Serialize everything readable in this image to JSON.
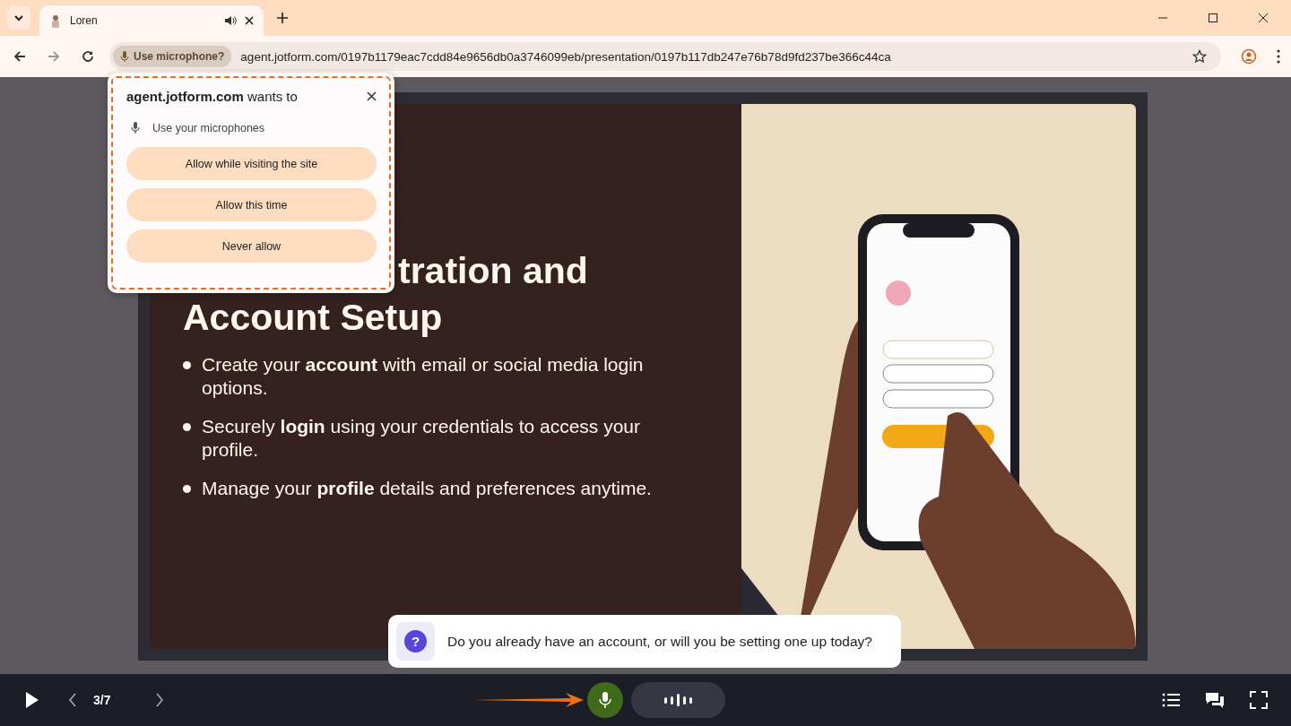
{
  "tab": {
    "title": "Loren"
  },
  "address_bar": {
    "permission_chip": "Use microphone?",
    "url": "agent.jotform.com/0197b1179eac7cdd84e9656db0a3746099eb/presentation/0197b117db247e76b78d9fd237be366c44ca"
  },
  "permission_popup": {
    "site": "agent.jotform.com",
    "title_rest": " wants to",
    "permission": "Use your microphones",
    "buttons": [
      "Allow while visiting the site",
      "Allow this time",
      "Never allow"
    ]
  },
  "slide": {
    "title_lines": [
      "tration and",
      "Account Setup"
    ],
    "bullets": [
      "Create your **account** with email or social media login options.",
      "Securely **login** using your credentials to access your profile.",
      "Manage your **profile** details and preferences anytime."
    ]
  },
  "question": {
    "icon": "?",
    "text": "Do you already have an account, or will you be setting one up today?"
  },
  "player": {
    "page": "3/7",
    "mic_on": true
  }
}
